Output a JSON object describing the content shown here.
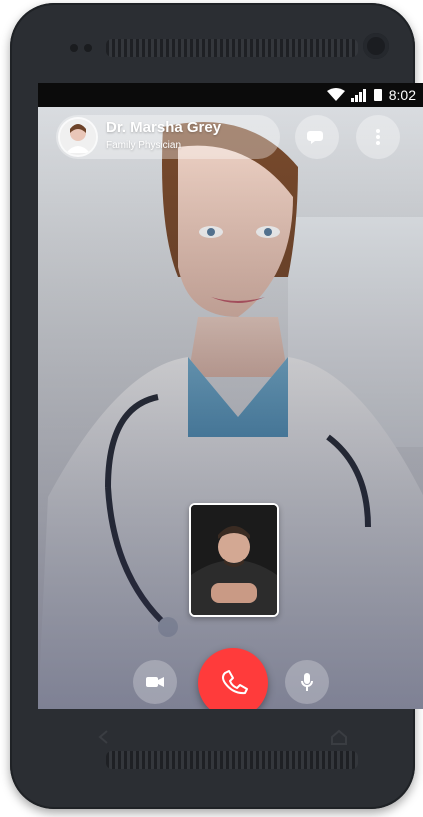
{
  "status": {
    "time": "8:02"
  },
  "call": {
    "doctor_name": "Dr. Marsha Grey",
    "doctor_title": "Family Physician"
  },
  "icons": {
    "chat": "chat-bubbles-icon",
    "more": "more-vertical-icon",
    "camera": "video-camera-icon",
    "end": "phone-hangup-icon",
    "mic": "microphone-icon",
    "back": "back-nav-icon",
    "home": "home-nav-icon"
  },
  "colors": {
    "end_call": "#ff3b3b",
    "phone_body": "#2b2e33"
  }
}
